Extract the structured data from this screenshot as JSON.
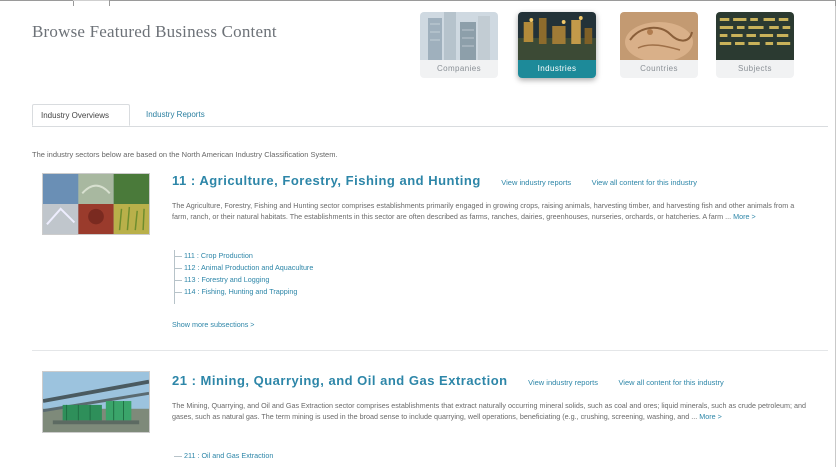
{
  "header": {
    "title": "Browse Featured Business Content"
  },
  "categories": [
    {
      "label": "Companies",
      "active": false
    },
    {
      "label": "Industries",
      "active": true
    },
    {
      "label": "Countries",
      "active": false
    },
    {
      "label": "Subjects",
      "active": false
    }
  ],
  "tabs": [
    {
      "label": "Industry Overviews",
      "active": true
    },
    {
      "label": "Industry Reports",
      "active": false
    }
  ],
  "intro": "The industry sectors below are based on the North American Industry Classification System.",
  "sections": [
    {
      "title": "11 : Agriculture, Forestry, Fishing and Hunting",
      "view_reports": "View industry reports",
      "view_content": "View all content for this industry",
      "description": "The Agriculture, Forestry, Fishing and Hunting sector comprises establishments primarily engaged in growing crops, raising animals, harvesting timber, and harvesting fish and other animals from a farm, ranch, or their natural habitats. The establishments in this sector are often described as farms, ranches, dairies, greenhouses, nurseries, orchards, or hatcheries. A farm ...",
      "more": "More >",
      "subsections": [
        "111 : Crop Production",
        "112 : Animal Production and Aquaculture",
        "113 : Forestry and Logging",
        "114 : Fishing, Hunting and Trapping"
      ],
      "show_more": "Show more subsections >"
    },
    {
      "title": "21 : Mining, Quarrying, and Oil and Gas Extraction",
      "view_reports": "View industry reports",
      "view_content": "View all content for this industry",
      "description": "The Mining, Quarrying, and Oil and Gas Extraction sector comprises establishments that extract naturally occurring mineral solids, such as coal and ores; liquid minerals, such as crude petroleum; and gases, such as natural gas. The term mining is used in the broad sense to include quarrying, well operations, beneficiating (e.g., crushing, screening, washing, and ...",
      "more": "More >",
      "subsections": [
        "211 : Oil and Gas Extraction"
      ]
    }
  ],
  "colors": {
    "accent": "#1d8a99",
    "link": "#2d86a8",
    "title_gray": "#6d7278"
  }
}
